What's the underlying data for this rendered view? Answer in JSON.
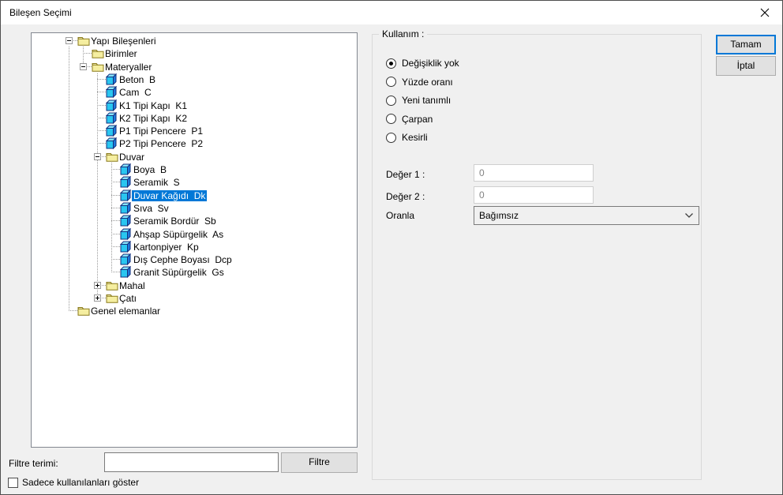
{
  "window": {
    "title": "Bileşen Seçimi",
    "close_icon": "x"
  },
  "tree": {
    "items": [
      {
        "label": "Yapı Bileşenleri",
        "depth": 0,
        "icon": "folder",
        "expand": "minus",
        "selected": false
      },
      {
        "label": "Birimler",
        "depth": 1,
        "icon": "folder",
        "expand": "none",
        "selected": false
      },
      {
        "label": "Materyaller",
        "depth": 1,
        "icon": "folder",
        "expand": "minus",
        "selected": false
      },
      {
        "label": "Beton  B",
        "depth": 2,
        "icon": "cube",
        "expand": "none",
        "selected": false
      },
      {
        "label": "Cam  C",
        "depth": 2,
        "icon": "cube",
        "expand": "none",
        "selected": false
      },
      {
        "label": "K1 Tipi Kapı  K1",
        "depth": 2,
        "icon": "cube",
        "expand": "none",
        "selected": false
      },
      {
        "label": "K2 Tipi Kapı  K2",
        "depth": 2,
        "icon": "cube",
        "expand": "none",
        "selected": false
      },
      {
        "label": "P1 Tipi Pencere  P1",
        "depth": 2,
        "icon": "cube",
        "expand": "none",
        "selected": false
      },
      {
        "label": "P2 Tipi Pencere  P2",
        "depth": 2,
        "icon": "cube",
        "expand": "none",
        "selected": false
      },
      {
        "label": "Duvar",
        "depth": 2,
        "icon": "folder",
        "expand": "minus",
        "selected": false
      },
      {
        "label": "Boya  B",
        "depth": 3,
        "icon": "cube",
        "expand": "none",
        "selected": false
      },
      {
        "label": "Seramik  S",
        "depth": 3,
        "icon": "cube",
        "expand": "none",
        "selected": false
      },
      {
        "label": "Duvar Kağıdı  Dk",
        "depth": 3,
        "icon": "cube",
        "expand": "none",
        "selected": true
      },
      {
        "label": "Sıva  Sv",
        "depth": 3,
        "icon": "cube",
        "expand": "none",
        "selected": false
      },
      {
        "label": "Seramik Bordür  Sb",
        "depth": 3,
        "icon": "cube",
        "expand": "none",
        "selected": false
      },
      {
        "label": "Ahşap Süpürgelik  As",
        "depth": 3,
        "icon": "cube",
        "expand": "none",
        "selected": false
      },
      {
        "label": "Kartonpiyer  Kp",
        "depth": 3,
        "icon": "cube",
        "expand": "none",
        "selected": false
      },
      {
        "label": "Dış Cephe Boyası  Dcp",
        "depth": 3,
        "icon": "cube",
        "expand": "none",
        "selected": false
      },
      {
        "label": "Granit Süpürgelik  Gs",
        "depth": 3,
        "icon": "cube",
        "expand": "none",
        "selected": false
      },
      {
        "label": "Mahal",
        "depth": 2,
        "icon": "folder",
        "expand": "plus",
        "selected": false
      },
      {
        "label": "Çatı",
        "depth": 2,
        "icon": "folder",
        "expand": "plus",
        "selected": false
      },
      {
        "label": "Genel elemanlar",
        "depth": 0,
        "icon": "folder",
        "expand": "none",
        "selected": false
      }
    ]
  },
  "usage": {
    "group_label": "Kullanım :",
    "options": [
      "Değişiklik yok",
      "Yüzde oranı",
      "Yeni tanımlı",
      "Çarpan",
      "Kesirli"
    ],
    "selected_index": 0
  },
  "fields": {
    "deger1_label": "Değer 1 :",
    "deger1_value": "0",
    "deger2_label": "Değer 2 :",
    "deger2_value": "0",
    "oranla_label": "Oranla",
    "oranla_value": "Bağımsız"
  },
  "buttons": {
    "ok": "Tamam",
    "cancel": "İptal",
    "filter": "Filtre"
  },
  "filter": {
    "label": "Filtre terimi:",
    "input_value": ""
  },
  "show_used_checkbox": {
    "label": "Sadece kullanılanları göster",
    "checked": false
  },
  "colors": {
    "selection": "#0078d7",
    "folder": "#f5eea0",
    "cube_front": "#29c6f0",
    "cube_side": "#1e78dc"
  }
}
